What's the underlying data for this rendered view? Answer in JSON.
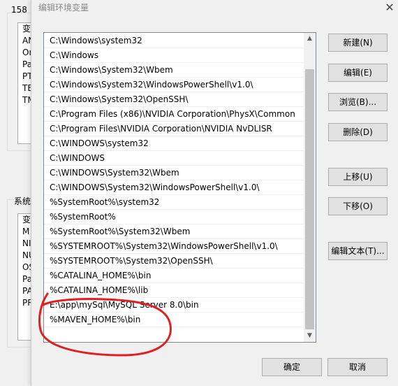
{
  "background_window": {
    "title_fragment": "158",
    "user_group": {
      "header": "变",
      "items": [
        "AN",
        "On",
        "Pa",
        "PT",
        "TE",
        "TM"
      ]
    },
    "system_group": {
      "label": "系统",
      "header": "变",
      "items": [
        "M",
        "NI",
        "NU",
        "OS",
        "Pa",
        "PA",
        "PR"
      ]
    }
  },
  "dialog": {
    "title": "编辑环境变量",
    "close_glyph": "✕",
    "paths": [
      "C:\\Windows\\system32",
      "C:\\Windows",
      "C:\\Windows\\System32\\Wbem",
      "C:\\Windows\\System32\\WindowsPowerShell\\v1.0\\",
      "C:\\Windows\\System32\\OpenSSH\\",
      "C:\\Program Files (x86)\\NVIDIA Corporation\\PhysX\\Common",
      "C:\\Program Files\\NVIDIA Corporation\\NVIDIA NvDLISR",
      "C:\\WINDOWS\\system32",
      "C:\\WINDOWS",
      "C:\\WINDOWS\\System32\\Wbem",
      "C:\\WINDOWS\\System32\\WindowsPowerShell\\v1.0\\",
      "%SystemRoot%\\system32",
      "%SystemRoot%",
      "%SystemRoot%\\System32\\Wbem",
      "%SYSTEMROOT%\\System32\\WindowsPowerShell\\v1.0\\",
      "%SYSTEMROOT%\\System32\\OpenSSH\\",
      "%CATALINA_HOME%\\bin",
      "%CATALINA_HOME%\\lib",
      "E:\\app\\mySql\\MySQL Server 8.0\\bin",
      "%MAVEN_HOME%\\bin"
    ],
    "buttons": {
      "new": "新建(N)",
      "edit": "编辑(E)",
      "browse": "浏览(B)...",
      "delete": "删除(D)",
      "move_up": "上移(U)",
      "move_down": "下移(O)",
      "edit_text": "编辑文本(T)...",
      "ok": "确定",
      "cancel": "取消"
    },
    "annotation_color": "#e02020"
  }
}
